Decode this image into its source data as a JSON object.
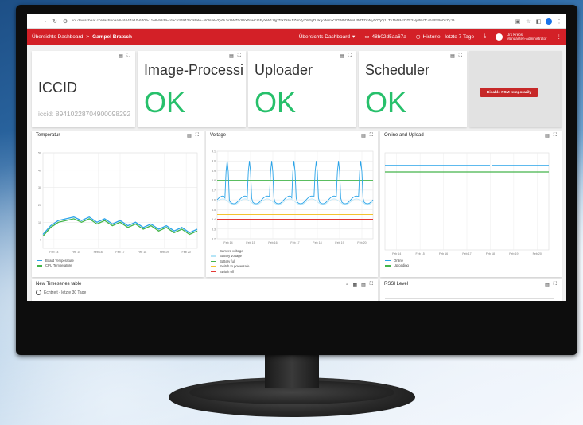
{
  "browser": {
    "url": "iot.davischeaf.ch/dashboard/4d447a10-6409-11e8-92d9-cdacfcf0942e?state=W3siaWQiOiJvZWZhdWx0IiwicGFyYW1zIjp7fX0sInJlZmVyZW5jZUlkIjoiMmY3OWM2NmUtMTZmNy00YjQ1LTk1MzMtOTk2NjdhNTc4NzE3In0sZyJ9...",
    "icons": [
      "back-arrow",
      "forward-arrow",
      "reload",
      "site-info",
      "translate",
      "star",
      "extension",
      "profile",
      "kebab"
    ]
  },
  "header": {
    "crumb_root": "Übersichts Dashboard",
    "crumb_sep": ">",
    "crumb_current": "Gampel Bratsch",
    "dashboard_select": "Übersichts Dashboard",
    "device_id": "48b02d5aa67a",
    "history": "Historie - letzte 7 Tage",
    "user_name": "Urs Krebs",
    "user_role": "Mandanten-Administrator",
    "accent": "#d32027"
  },
  "cards": {
    "iccid_title": "ICCID",
    "iccid_value": "iccid: 89410228704900098292",
    "image_title": "Image-Processi",
    "image_status": "OK",
    "uploader_title": "Uploader",
    "uploader_status": "OK",
    "scheduler_title": "Scheduler",
    "scheduler_status": "OK",
    "psm_button": "Disable PSM temporarily",
    "ok_color": "#27c06b"
  },
  "panels": {
    "temperature_title": "Temperatur",
    "voltage_title": "Voltage",
    "online_title": "Online and Upload",
    "timeseries_title": "New Timeseries table",
    "timeseries_sub": "Echtzeit - letzte 30 Tage",
    "rssi_title": "RSSI Level"
  },
  "chart_data": [
    {
      "type": "line",
      "title": "Temperatur",
      "x": [
        "Feb 14",
        "Feb 15",
        "Feb 16",
        "Feb 17",
        "Feb 18",
        "Feb 19",
        "Feb 20"
      ],
      "ylim": [
        -5,
        50
      ],
      "yticks": [
        50,
        40,
        30,
        20,
        10,
        0
      ],
      "series": [
        {
          "name": "Board Temperature",
          "color": "#29a3e8",
          "values": [
            3,
            8,
            11,
            12,
            13,
            11,
            13,
            10,
            12,
            9,
            11,
            8,
            10,
            7,
            9,
            6,
            8,
            5,
            7,
            4,
            6
          ]
        },
        {
          "name": "CPU Temperature",
          "color": "#43b54a",
          "values": [
            2,
            7,
            10,
            11,
            12,
            10,
            12,
            9,
            11,
            8,
            10,
            7,
            9,
            6,
            8,
            5,
            7,
            4,
            6,
            3,
            5
          ]
        }
      ],
      "grid": true,
      "legend": "bottom"
    },
    {
      "type": "line",
      "title": "Voltage",
      "x": [
        "Feb 14",
        "Feb 15",
        "Feb 16",
        "Feb 17",
        "Feb 18",
        "Feb 19",
        "Feb 20"
      ],
      "ylim": [
        3.2,
        4.1
      ],
      "yticks": [
        4.1,
        4.0,
        3.9,
        3.8,
        3.7,
        3.6,
        3.5,
        3.4,
        3.3,
        3.2
      ],
      "series": [
        {
          "name": "Camera voltage",
          "color": "#29a3e8"
        },
        {
          "name": "Battery voltage",
          "color": "#b6e5f7"
        },
        {
          "name": "Battery full",
          "color": "#43b54a",
          "value": 3.8
        },
        {
          "name": "Switch to powersafe",
          "color": "#f4c430",
          "value": 3.45
        },
        {
          "name": "Switch off",
          "color": "#e53935",
          "value": 3.4
        }
      ],
      "grid": true,
      "legend": "bottom"
    },
    {
      "type": "line",
      "title": "Online and Upload",
      "x": [
        "Feb 14",
        "Feb 15",
        "Feb 16",
        "Feb 17",
        "Feb 18",
        "Feb 19",
        "Feb 20"
      ],
      "series": [
        {
          "name": "Online",
          "color": "#29a3e8"
        },
        {
          "name": "Uploading",
          "color": "#43b54a"
        }
      ],
      "grid": true,
      "legend": "bottom"
    }
  ]
}
